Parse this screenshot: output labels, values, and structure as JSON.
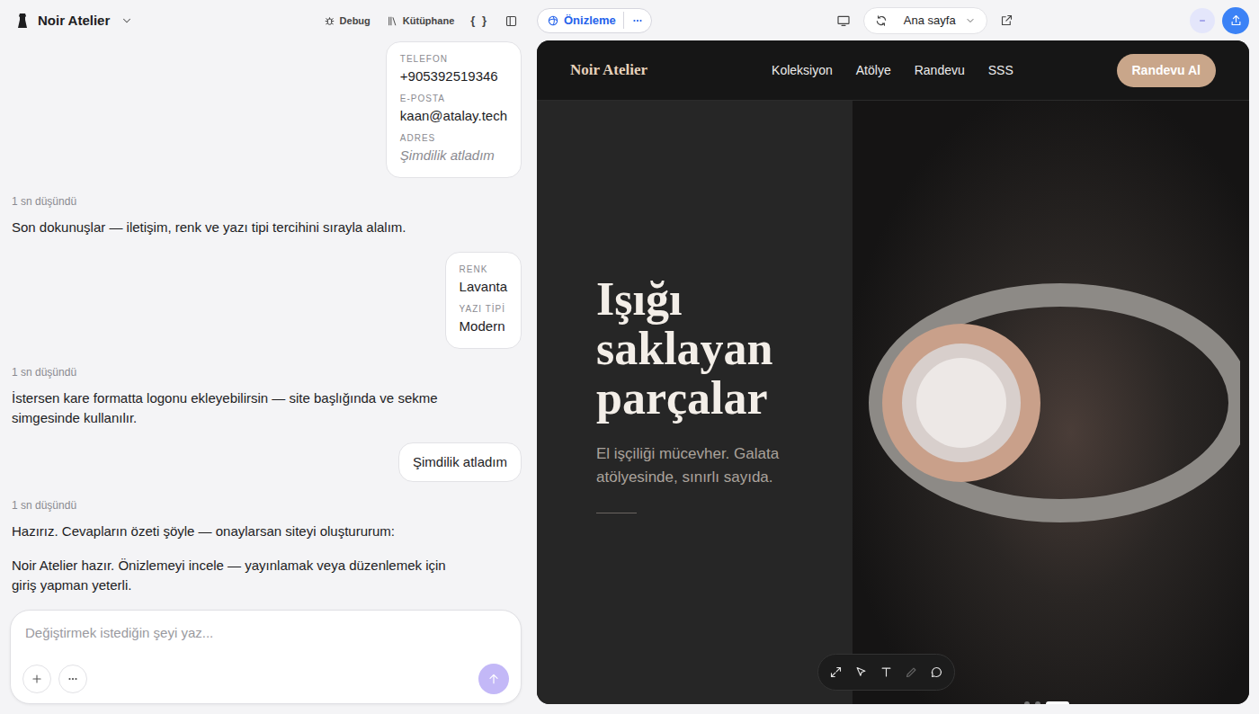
{
  "app": {
    "project": "Noir Atelier",
    "tools": [
      {
        "label": "Debug",
        "icon": "bug"
      },
      {
        "label": "Kütüphane",
        "icon": "library"
      },
      {
        "label": "{ }",
        "icon": "none"
      }
    ]
  },
  "chat": {
    "messages": [
      {
        "kind": "fields",
        "fields": [
          {
            "label": "TELEFON",
            "value": "+905392519346",
            "skipped": false
          },
          {
            "label": "E-POSTA",
            "value": "kaan@atalay.tech",
            "skipped": false
          },
          {
            "label": "ADRES",
            "value": "Şimdilik atladım",
            "skipped": true
          }
        ]
      },
      {
        "kind": "thinking",
        "text": "1 sn düşündü"
      },
      {
        "kind": "assistant",
        "text": "Son dokunuşlar — iletişim, renk ve yazı tipi tercihini sırayla alalım."
      },
      {
        "kind": "fields",
        "fields": [
          {
            "label": "RENK",
            "value": "Lavanta",
            "skipped": false
          },
          {
            "label": "YAZI TİPİ",
            "value": "Modern",
            "skipped": false
          }
        ]
      },
      {
        "kind": "thinking",
        "text": "1 sn düşündü"
      },
      {
        "kind": "assistant",
        "text": "İstersen kare formatta logonu ekleyebilirsin — site başlığında ve sekme simgesinde kullanılır."
      },
      {
        "kind": "user",
        "text": "Şimdilik atladım"
      },
      {
        "kind": "thinking",
        "text": "1 sn düşündü"
      },
      {
        "kind": "assistant",
        "text": "Hazırız. Cevapların özeti şöyle — onaylarsan siteyi oluştururum:"
      },
      {
        "kind": "assistant",
        "text": "Noir Atelier hazır. Önizlemeyi incele — yayınlamak veya düzenlemek için giriş yapman yeterli."
      }
    ],
    "input": {
      "placeholder": "Değiştirmek istediğin şeyi yaz...",
      "send_disabled": true
    }
  },
  "preview_bar": {
    "tab": "Önizleme",
    "page": "Ana sayfa"
  },
  "site": {
    "logo": "Noir Atelier",
    "nav": [
      "Koleksiyon",
      "Atölye",
      "Randevu",
      "SSS"
    ],
    "cta": "Randevu Al",
    "hero": {
      "title_lines": [
        "Işığı",
        "saklayan",
        "parçalar"
      ],
      "subtitle": "El işçiliği mücevher. Galata atölyesinde, sınırlı sayıda."
    },
    "tools": [
      {
        "icon": "expand",
        "disabled": false
      },
      {
        "icon": "pointer",
        "disabled": false
      },
      {
        "icon": "text",
        "disabled": false
      },
      {
        "icon": "pencil",
        "disabled": true
      },
      {
        "icon": "comment",
        "disabled": false
      }
    ],
    "slides": [
      {
        "selected": false
      },
      {
        "selected": false
      },
      {
        "selected": true
      }
    ]
  }
}
